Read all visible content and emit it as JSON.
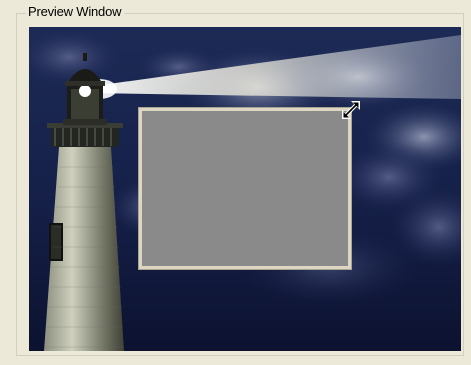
{
  "group": {
    "title": "Preview Window"
  },
  "icons": {
    "resize": "diagonal-resize-arrow-icon"
  },
  "colors": {
    "dialog_background": "#ECE9D8",
    "selection_fill": "#8A8A8A",
    "selection_border": "#DCD6C2"
  }
}
